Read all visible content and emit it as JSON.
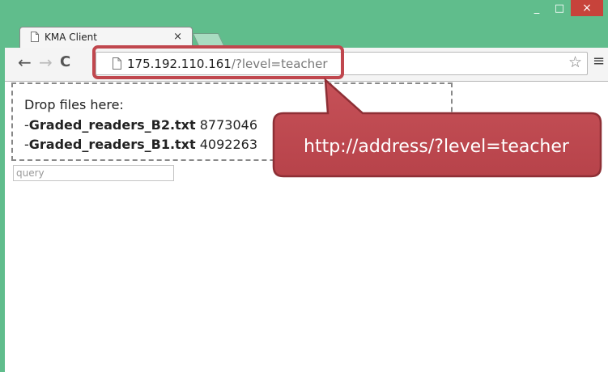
{
  "window": {
    "controls": {
      "minimize": "_",
      "maximize": "□",
      "close": "×"
    }
  },
  "tab": {
    "title": "KMA Client",
    "close": "×"
  },
  "toolbar": {
    "back": "←",
    "forward": "→",
    "reload": "C",
    "url_host": "175.192.110.161",
    "url_path": "/?level=teacher",
    "star": "☆",
    "menu": "≡"
  },
  "page": {
    "drop_title": "Drop files here:",
    "files": [
      {
        "prefix": "-",
        "name": "Graded_readers_B2.txt",
        "size": "8773046"
      },
      {
        "prefix": "-",
        "name": "Graded_readers_B1.txt",
        "size": "4092263"
      }
    ],
    "query_placeholder": "query"
  },
  "annotation": {
    "text": "http://address/?level=teacher",
    "color": "#c0474e"
  },
  "colors": {
    "frame": "#60bd8c",
    "close_button": "#c7433b"
  }
}
